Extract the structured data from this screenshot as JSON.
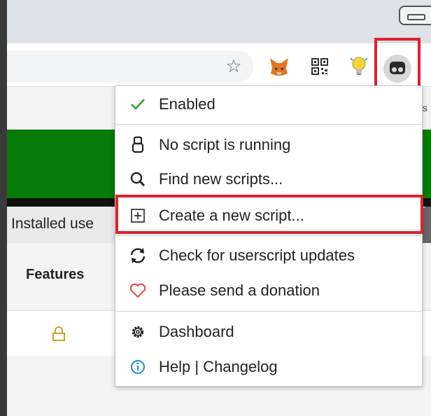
{
  "browser": {
    "extensions": [
      {
        "name": "metamask-fox"
      },
      {
        "name": "qr-code"
      },
      {
        "name": "lightbulb"
      },
      {
        "name": "tampermonkey",
        "highlighted": true
      }
    ]
  },
  "page": {
    "os_text": "os",
    "installed_tab": "Installed use",
    "features_label": "Features"
  },
  "menu": {
    "items": [
      {
        "label": "Enabled",
        "icon": "check-icon"
      },
      {
        "label": "No script is running",
        "icon": "script-8-icon"
      },
      {
        "label": "Find new scripts...",
        "icon": "search-icon"
      },
      {
        "label": "Create a new script...",
        "icon": "plus-box-icon",
        "highlighted": true
      },
      {
        "label": "Check for userscript updates",
        "icon": "refresh-icon"
      },
      {
        "label": "Please send a donation",
        "icon": "heart-icon"
      },
      {
        "label": "Dashboard",
        "icon": "gear-icon"
      },
      {
        "label": "Help | Changelog",
        "icon": "info-icon"
      }
    ]
  },
  "colors": {
    "green_band": "#067b06",
    "highlight": "#e0202e",
    "check": "#2e9e2e",
    "heart": "#e8504a",
    "info": "#1a8fd6",
    "lock": "#c9a227"
  }
}
